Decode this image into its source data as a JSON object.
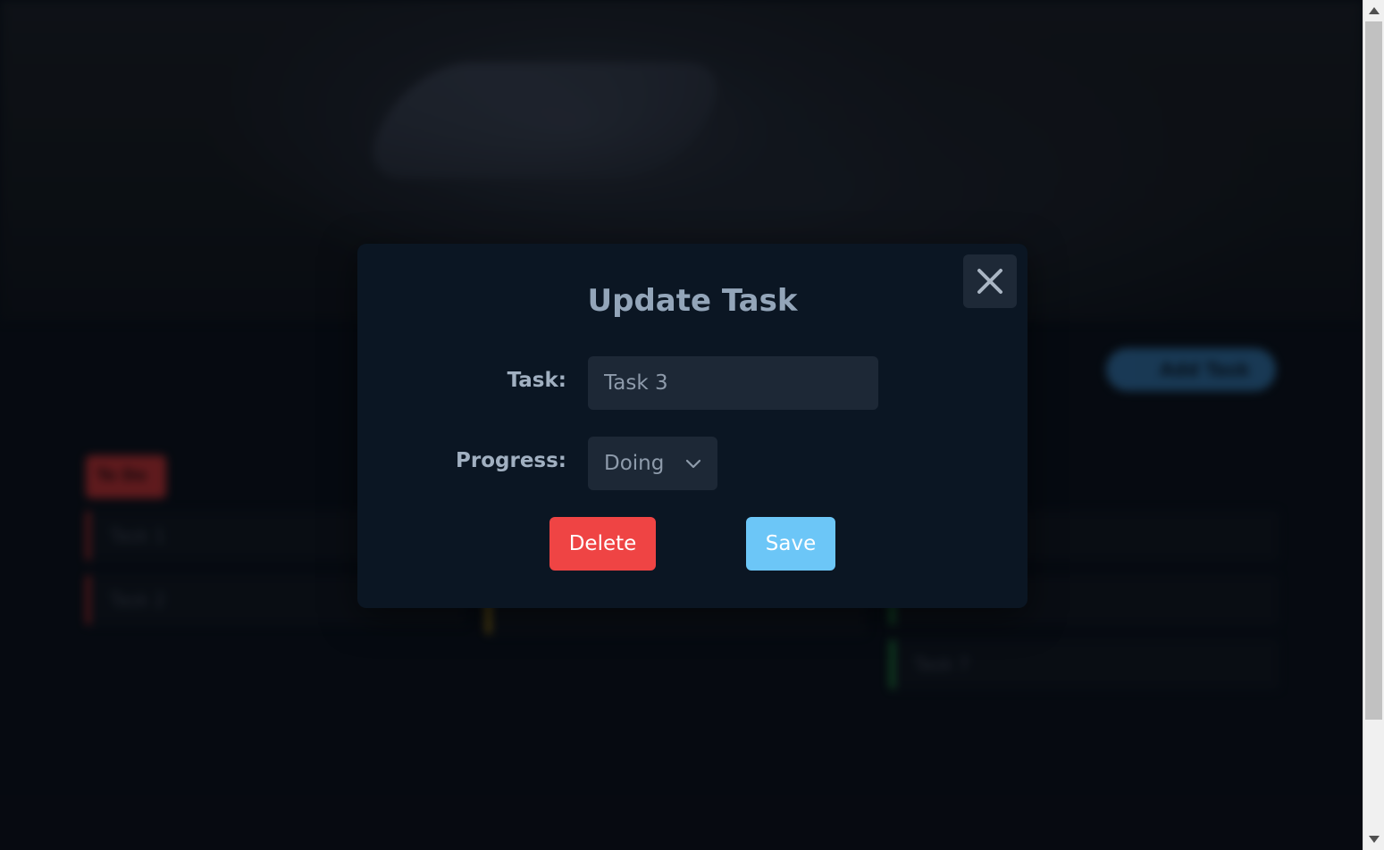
{
  "modal": {
    "title": "Update Task",
    "task_label": "Task:",
    "task_value": "Task 3",
    "progress_label": "Progress:",
    "progress_selected": "Doing",
    "delete_label": "Delete",
    "save_label": "Save",
    "close_icon": "close-icon"
  },
  "background": {
    "add_button_label": "Add Task",
    "todo_column_label": "To Do",
    "cards": [
      "Task 1",
      "Task 2",
      "Task 7"
    ]
  },
  "colors": {
    "delete": "#ef4444",
    "save": "#6cc6f7",
    "modal_bg": "#0b1623",
    "todo": "#c62f2f",
    "doing": "#b88a10",
    "done": "#1f8a3a"
  }
}
